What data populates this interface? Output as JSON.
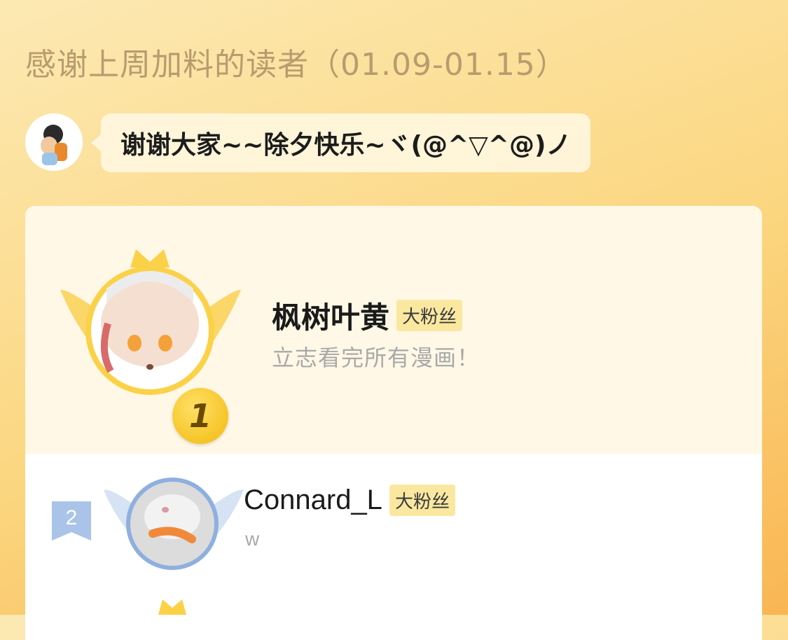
{
  "header": {
    "title": "感谢上周加料的读者（01.09-01.15）"
  },
  "author_message": {
    "text": "谢谢大家~~除夕快乐~ヾ(@^▽^@)ノ"
  },
  "ranking": [
    {
      "rank": "1",
      "name": "枫树叶黄",
      "tag": "大粉丝",
      "motto": "立志看完所有漫画！"
    },
    {
      "rank": "2",
      "name": "Connard_L",
      "tag": "大粉丝",
      "motto": "w"
    }
  ],
  "colors": {
    "background_gradient": [
      "#fce9b3",
      "#fbd67f",
      "#f9b653"
    ],
    "gold": "#f2b90c",
    "tag_bg": "#fbe8a0",
    "rank2_blue": "#a9c4e8"
  },
  "icons": [
    "crown-icon",
    "wings-icon",
    "rank-badge-icon",
    "ribbon-flag-icon"
  ]
}
